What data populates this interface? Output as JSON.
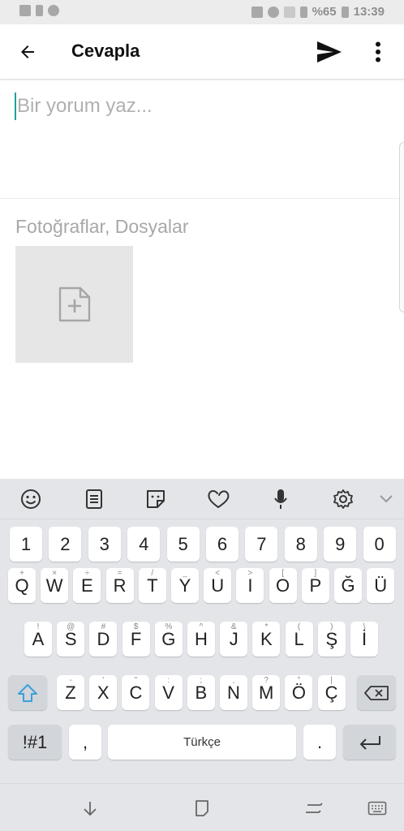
{
  "status_bar": {
    "battery_text": "%65",
    "time": "13:39"
  },
  "app_bar": {
    "title": "Cevapla",
    "back_icon": "arrow-back-icon",
    "send_icon": "send-icon",
    "more_icon": "more-vert-icon"
  },
  "comment": {
    "value": "",
    "placeholder": "Bir yorum yaz..."
  },
  "attachments": {
    "label": "Fotoğraflar, Dosyalar",
    "add_icon": "add-file-icon"
  },
  "keyboard": {
    "toolbar_icons": [
      "emoji-icon",
      "clipboard-icon",
      "sticker-icon",
      "heart-icon",
      "mic-icon",
      "settings-icon",
      "chevron-down-icon"
    ],
    "row_numbers": [
      "1",
      "2",
      "3",
      "4",
      "5",
      "6",
      "7",
      "8",
      "9",
      "0"
    ],
    "row1": [
      {
        "key": "Q",
        "hint": "+"
      },
      {
        "key": "W",
        "hint": "×"
      },
      {
        "key": "E",
        "hint": "÷"
      },
      {
        "key": "R",
        "hint": "="
      },
      {
        "key": "T",
        "hint": "/"
      },
      {
        "key": "Y",
        "hint": "_"
      },
      {
        "key": "U",
        "hint": "<"
      },
      {
        "key": "I",
        "hint": ">"
      },
      {
        "key": "O",
        "hint": "["
      },
      {
        "key": "P",
        "hint": "]"
      },
      {
        "key": "Ğ",
        "hint": ""
      },
      {
        "key": "Ü",
        "hint": ""
      }
    ],
    "row2": [
      {
        "key": "A",
        "hint": "!"
      },
      {
        "key": "S",
        "hint": "@"
      },
      {
        "key": "D",
        "hint": "#"
      },
      {
        "key": "F",
        "hint": "$"
      },
      {
        "key": "G",
        "hint": "%"
      },
      {
        "key": "H",
        "hint": "^"
      },
      {
        "key": "J",
        "hint": "&"
      },
      {
        "key": "K",
        "hint": "*"
      },
      {
        "key": "L",
        "hint": "("
      },
      {
        "key": "Ş",
        "hint": ")"
      },
      {
        "key": "İ",
        "hint": "\\"
      }
    ],
    "row3": [
      {
        "key": "Z",
        "hint": "-"
      },
      {
        "key": "X",
        "hint": "'"
      },
      {
        "key": "C",
        "hint": "\""
      },
      {
        "key": "V",
        "hint": ":"
      },
      {
        "key": "B",
        "hint": ";"
      },
      {
        "key": "N",
        "hint": ","
      },
      {
        "key": "M",
        "hint": "?"
      },
      {
        "key": "Ö",
        "hint": "°"
      },
      {
        "key": "Ç",
        "hint": "|"
      }
    ],
    "symbols_label": "!#1",
    "comma_label": ",",
    "space_label": "Türkçe",
    "period_label": "."
  },
  "nav_bar": {
    "icons": [
      "nav-down-icon",
      "nav-home-icon",
      "nav-recent-icon",
      "nav-keyboard-icon"
    ]
  }
}
